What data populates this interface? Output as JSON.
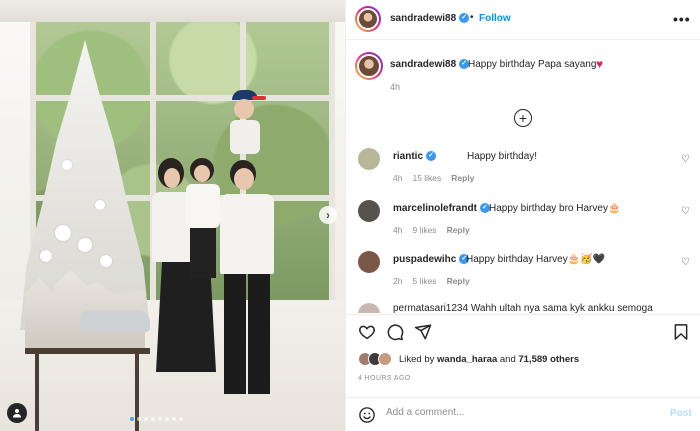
{
  "post": {
    "username": "sandradewi88",
    "separator": "•",
    "follow_label": "Follow",
    "more_label": "•••",
    "caption": {
      "username": "sandradewi88",
      "text": "Happy birthday Papa sayang",
      "time": "4h"
    },
    "load_more_label": "+"
  },
  "comments": [
    {
      "username": "riantic",
      "text": "Happy birthday!",
      "time": "4h",
      "likes": "15 likes",
      "reply": "Reply",
      "avatar_color": "#b8b79a"
    },
    {
      "username": "marcelinolefrandt",
      "text": "Happy birthday bro Harvey🎂",
      "time": "4h",
      "likes": "9 likes",
      "reply": "Reply",
      "avatar_color": "#55524f"
    },
    {
      "username": "puspadewihc",
      "text": "Happy birthday Harvey🎂🥳🖤",
      "time": "2h",
      "likes": "5 likes",
      "reply": "Reply",
      "avatar_color": "#7a5848"
    }
  ],
  "cut_comment_text": "permatasari1234  Wahh ultah nya sama kyk ankku semoga",
  "likes": {
    "prefix": "Liked by ",
    "first_user": "wanda_haraa",
    "middle": " and ",
    "count": "71,589 others"
  },
  "date": "4 HOURS AGO",
  "comment_box": {
    "placeholder": "Add a comment...",
    "post_label": "Post"
  },
  "carousel": {
    "count": 8,
    "active_index": 0
  },
  "icons": [
    "heart-icon",
    "comment-icon",
    "share-icon",
    "bookmark-icon",
    "emoji-icon",
    "tag-user-icon",
    "chevron-right-icon",
    "add-circle-icon",
    "verified-badge-icon",
    "more-options-icon"
  ],
  "colors": {
    "link_blue": "#0095f6",
    "post_disabled": "#b2dffc",
    "muted": "#8e8e8e",
    "verified": "#3897f0",
    "heart_red": "#e0245e"
  }
}
